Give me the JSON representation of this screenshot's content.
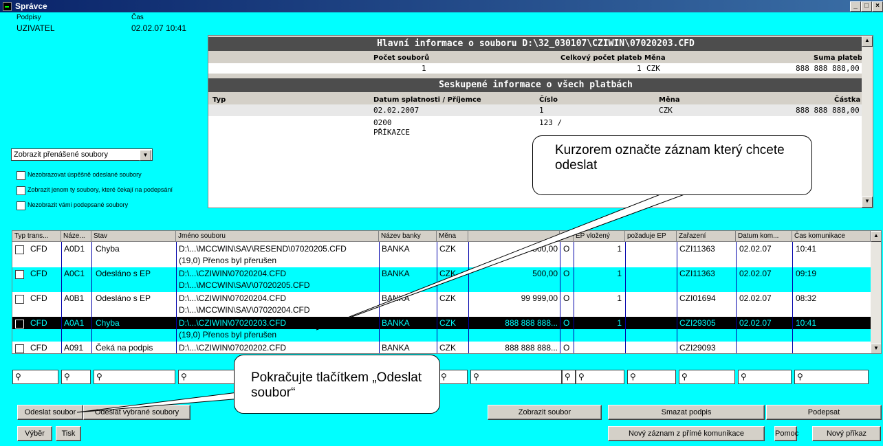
{
  "window": {
    "title": "Správce",
    "minimize": "_",
    "maximize": "□",
    "close": "×"
  },
  "top_left": {
    "signatures_label": "Podpisy",
    "signatures_value": "UZIVATEL",
    "time_label": "Čas",
    "time_value": "02.02.07 10:41"
  },
  "file_info": {
    "header": "Hlavní informace o souboru D:\\32_030107\\CZIWIN\\07020203.CFD",
    "col_file_count": "Počet souborů",
    "col_total_payments": "Celkový počet plateb",
    "col_currency": "Měna",
    "col_sum": "Suma plateb",
    "file_count": "1",
    "total_payments": "1",
    "currency": "CZK",
    "sum": "888 888 888,00"
  },
  "grouped_info": {
    "header": "Seskupené informace o všech platbách",
    "col_type": "Typ",
    "col_due": "Datum splatnosti / Příjemce",
    "col_number": "Číslo",
    "col_currency": "Měna",
    "col_amount": "Částka",
    "due": "02.02.2007",
    "number": "1",
    "currency": "CZK",
    "amount": "888 888 888,00",
    "line2_a": "0200",
    "line2_b": "123 /",
    "line3": "PŘÍKAZCE"
  },
  "filters": {
    "view_select": "Zobrazit přenášené soubory",
    "check1": "Nezobrazovat úspěšně odeslané soubory",
    "check2": "Zobrazit jenom ty soubory, které čekají na podepsání",
    "check3": "Nezobrazit vámi podepsané soubory"
  },
  "table": {
    "headers": [
      "Typ trans...",
      "Náze...",
      "Stav",
      "Jméno souboru",
      "Název banky",
      "Měna",
      "",
      "A.",
      "EP vložený",
      "požaduje EP",
      "Zařazení",
      "Datum kom...",
      "Čas komunikace"
    ],
    "rows": [
      {
        "type": "CFD",
        "name": "A0D1",
        "status": "Chyba",
        "file1": "D:\\...\\MCCWIN\\SAV\\RESEND\\07020205.CFD",
        "file2": "(19,0) Přenos byl přerušen",
        "bank": "BANKA",
        "currency": "CZK",
        "amount": "500,00",
        "a": "O",
        "ep": "1",
        "req": "",
        "class": "CZI11363",
        "date": "02.02.07",
        "time": "10:41"
      },
      {
        "type": "CFD",
        "name": "A0C1",
        "status": "Odesláno s EP",
        "file1": "D:\\...\\CZIWIN\\07020204.CFD",
        "file2": "D:\\...\\MCCWIN\\SAV\\07020205.CFD",
        "bank": "BANKA",
        "currency": "CZK",
        "amount": "500,00",
        "a": "O",
        "ep": "1",
        "req": "",
        "class": "CZI11363",
        "date": "02.02.07",
        "time": "09:19"
      },
      {
        "type": "CFD",
        "name": "A0B1",
        "status": "Odesláno s EP",
        "file1": "D:\\...\\CZIWIN\\07020204.CFD",
        "file2": "D:\\...\\MCCWIN\\SAV\\07020204.CFD",
        "bank": "BANKA",
        "currency": "CZK",
        "amount": "99 999,00",
        "a": "O",
        "ep": "1",
        "req": "",
        "class": "CZI01694",
        "date": "02.02.07",
        "time": "08:32"
      },
      {
        "type": "CFD",
        "name": "A0A1",
        "status": "Chyba",
        "file1": "D:\\...\\CZIWIN\\07020203.CFD",
        "file2": "(19,0) Přenos byl přerušen",
        "bank": "BANKA",
        "currency": "CZK",
        "amount": "888 888 888...",
        "a": "O",
        "ep": "1",
        "req": "",
        "class": "CZI29305",
        "date": "02.02.07",
        "time": "10:41"
      },
      {
        "type": "CFD",
        "name": "A091",
        "status": "Čeká na podpis",
        "file1": "D:\\...\\CZIWIN\\07020202.CFD",
        "file2": "",
        "bank": "BANKA",
        "currency": "CZK",
        "amount": "888 888 888...",
        "a": "O",
        "ep": "",
        "req": "",
        "class": "CZI29093",
        "date": "",
        "time": ""
      }
    ]
  },
  "buttons": {
    "send_file": "Odeslat soubor",
    "send_selected": "Odeslat vybrané soubory",
    "show_file": "Zobrazit soubor",
    "delete_signature": "Smazat podpis",
    "sign": "Podepsat",
    "select": "Výběr",
    "print": "Tisk",
    "new_record": "Nový záznam z přímé komunikace",
    "help": "Pomoc",
    "new_order": "Nový příkaz"
  },
  "callouts": {
    "top": "Kurzorem označte záznam který chcete odeslat",
    "bottom": "Pokračujte tlačítkem „Odeslat soubor“"
  },
  "colors": {
    "background": "#00ffff",
    "title": "#0a246a",
    "selected_row": "#000000",
    "highlight_row": "#00ffff",
    "header_bar": "#4d4d4d"
  },
  "icons": {
    "filter": "magnifier-icon"
  }
}
